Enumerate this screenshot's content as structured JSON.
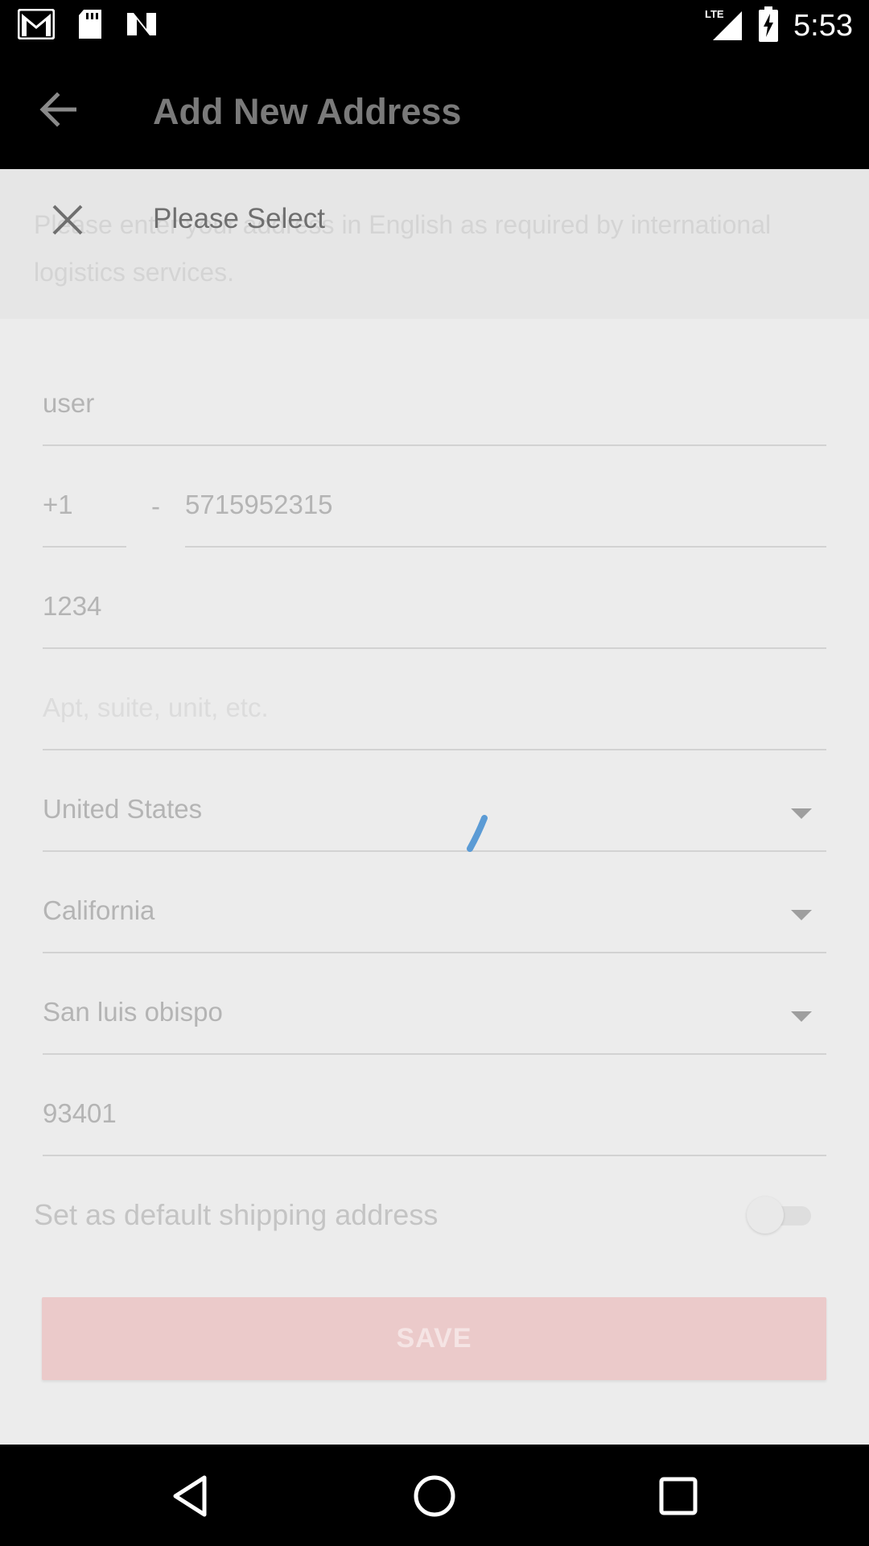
{
  "status_bar": {
    "time": "5:53",
    "network": "LTE",
    "icons": [
      "gmail-icon",
      "sd-card-icon",
      "n-app-icon",
      "signal-icon",
      "battery-charging-icon"
    ]
  },
  "app_bar": {
    "title": "Add New Address",
    "back_icon": "arrow-left-icon"
  },
  "notice": {
    "text": "Please enter your address in English as required by international logistics services."
  },
  "sheet": {
    "close_icon": "close-icon",
    "title": "Please Select"
  },
  "form": {
    "name": {
      "value": "user"
    },
    "phone": {
      "code": "+1",
      "separator": "-",
      "number": "5715952315"
    },
    "address1": {
      "value": "1234"
    },
    "address2": {
      "placeholder": "Apt, suite, unit, etc."
    },
    "country": {
      "value": "United States"
    },
    "state": {
      "value": "California"
    },
    "city": {
      "value": "San luis obispo"
    },
    "zip": {
      "value": "93401"
    },
    "default_label": "Set as default shipping address",
    "default_enabled": false
  },
  "save_label": "SAVE",
  "nav_bar": {
    "icons": [
      "back-triangle-icon",
      "home-circle-icon",
      "recents-square-icon"
    ]
  },
  "colors": {
    "save_bg": "#ebcaca",
    "spinner": "#5b9bd5"
  }
}
